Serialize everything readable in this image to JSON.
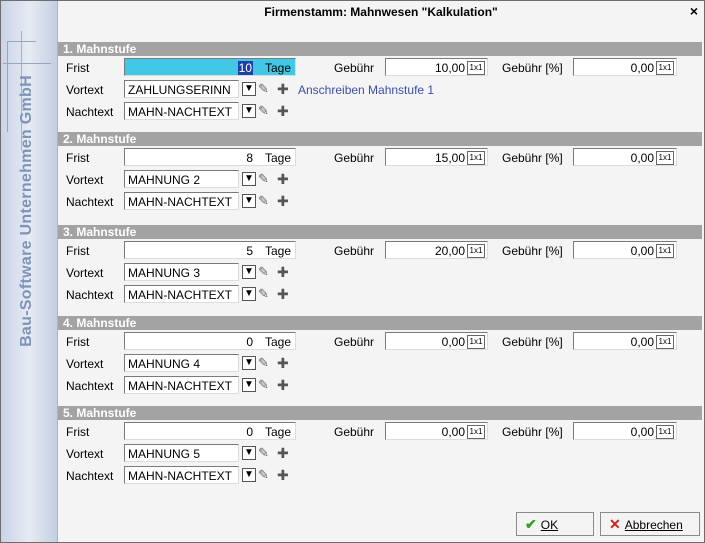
{
  "window": {
    "title": "Firmenstamm: Mahnwesen \"Kalkulation\"",
    "close": "×"
  },
  "sidebar": {
    "brand": "Bau-Software Unternehmen GmbH"
  },
  "labels": {
    "frist": "Frist",
    "vortext": "Vortext",
    "nachtext": "Nachtext",
    "gebuehr": "Gebühr",
    "gebuehr_pct": "Gebühr [%]",
    "unit_tage": "Tage",
    "calc": "1x1"
  },
  "stages": [
    {
      "title": "1. Mahnstufe",
      "frist": "10",
      "vortext": "ZAHLUNGSERINN",
      "nachtext": "MAHN-NACHTEXT",
      "gebuehr": "10,00",
      "gebuehr_pct": "0,00",
      "link": "Anschreiben Mahnstufe 1"
    },
    {
      "title": "2. Mahnstufe",
      "frist": "8",
      "vortext": "MAHNUNG 2",
      "nachtext": "MAHN-NACHTEXT",
      "gebuehr": "15,00",
      "gebuehr_pct": "0,00"
    },
    {
      "title": "3. Mahnstufe",
      "frist": "5",
      "vortext": "MAHNUNG 3",
      "nachtext": "MAHN-NACHTEXT",
      "gebuehr": "20,00",
      "gebuehr_pct": "0,00"
    },
    {
      "title": "4. Mahnstufe",
      "frist": "0",
      "vortext": "MAHNUNG 4",
      "nachtext": "MAHN-NACHTEXT",
      "gebuehr": "0,00",
      "gebuehr_pct": "0,00"
    },
    {
      "title": "5. Mahnstufe",
      "frist": "0",
      "vortext": "MAHNUNG 5",
      "nachtext": "MAHN-NACHTEXT",
      "gebuehr": "0,00",
      "gebuehr_pct": "0,00"
    }
  ],
  "buttons": {
    "ok": "OK",
    "cancel": "Abbrechen"
  },
  "icons": {
    "dropdown": "chevron-down-icon",
    "edit": "pencil-icon",
    "add": "plus-icon",
    "ok": "check-icon",
    "cancel": "x-icon"
  },
  "colors": {
    "stage_header": "#a3a3a3",
    "active_field": "#41c8e6",
    "link": "#3a4fa8",
    "sidebar": "#c9d4e6"
  }
}
